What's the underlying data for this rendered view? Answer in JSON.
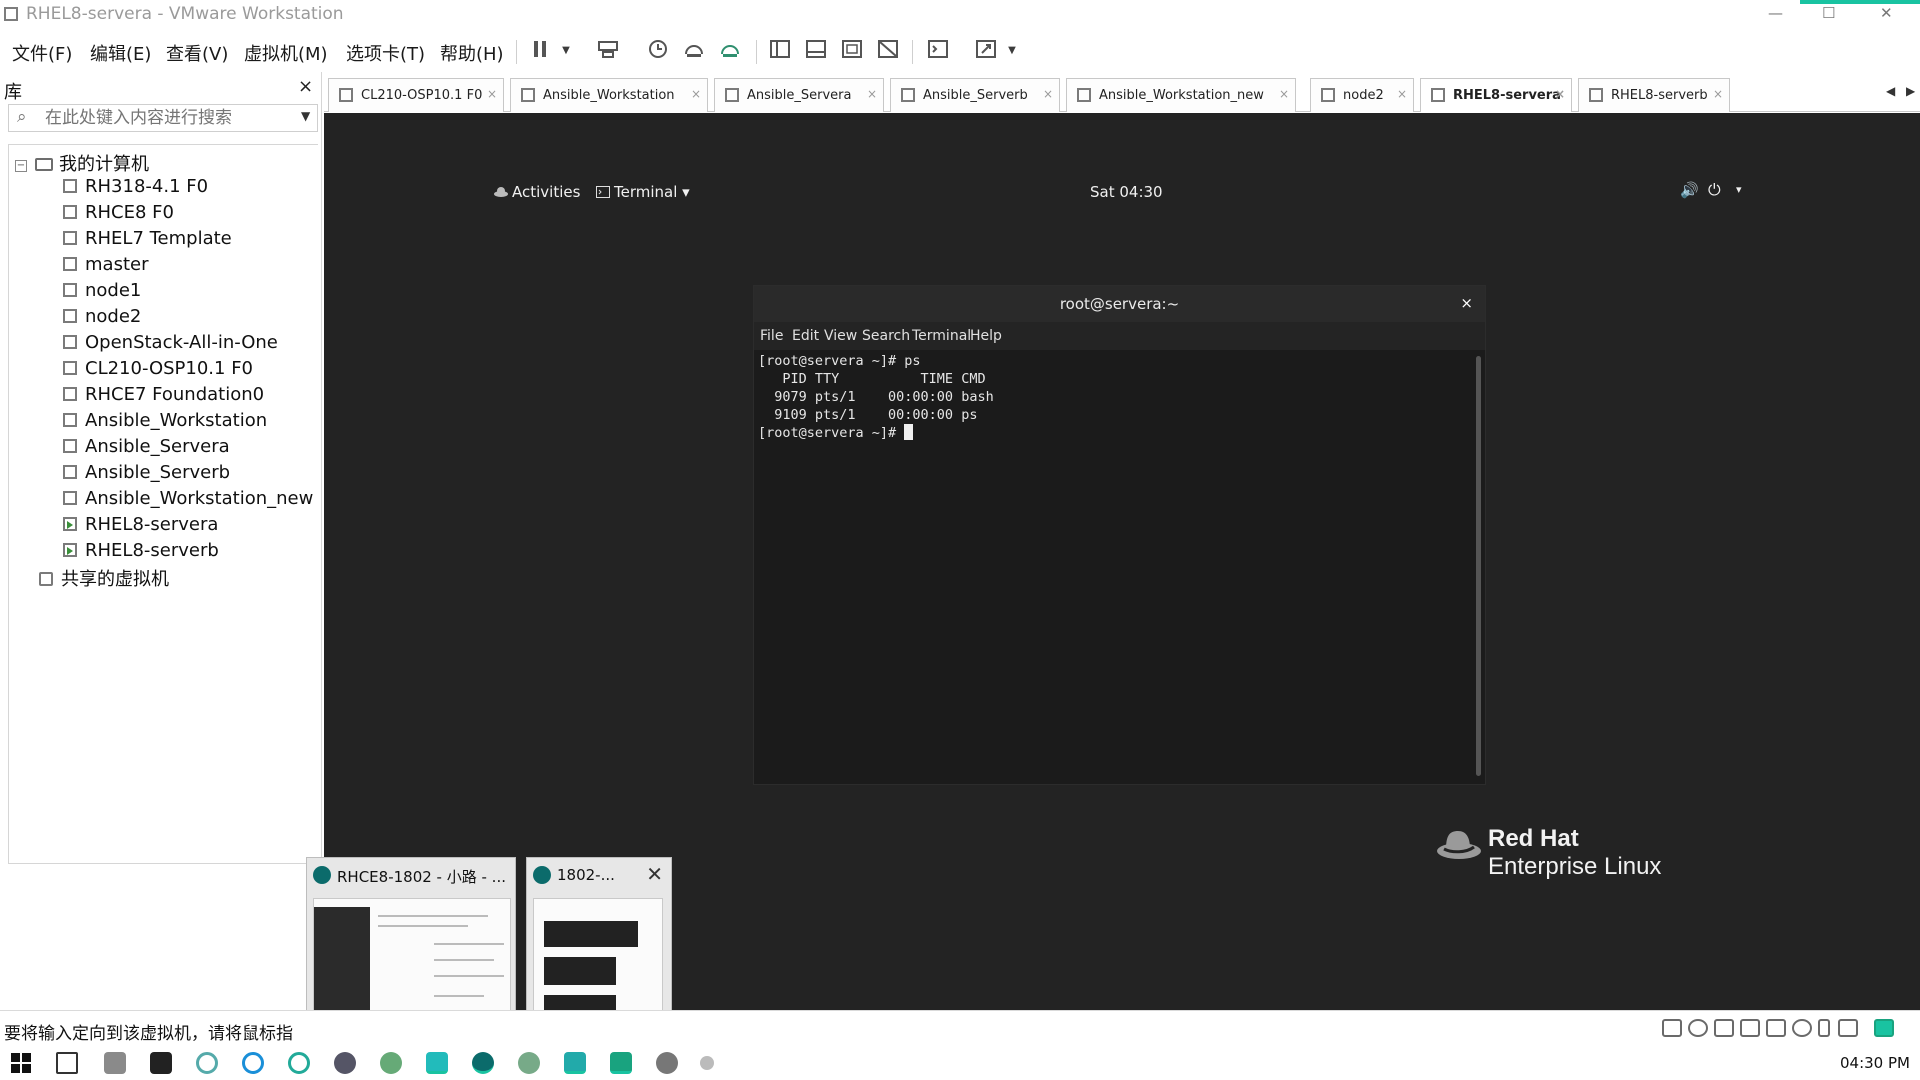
{
  "window": {
    "title": "RHEL8-servera - VMware Workstation",
    "min": "—",
    "max": "☐",
    "close": "✕"
  },
  "menu": [
    "文件(F)",
    "编辑(E)",
    "查看(V)",
    "虚拟机(M)",
    "选项卡(T)",
    "帮助(H)"
  ],
  "library": {
    "title": "库",
    "close": "×",
    "search_placeholder": "在此处键入内容进行搜索",
    "root": "我的计算机",
    "vms": [
      {
        "name": "RH318-4.1 F0",
        "running": false
      },
      {
        "name": "RHCE8 F0",
        "running": false
      },
      {
        "name": "RHEL7 Template",
        "running": false
      },
      {
        "name": "master",
        "running": false
      },
      {
        "name": "node1",
        "running": false
      },
      {
        "name": "node2",
        "running": false
      },
      {
        "name": "OpenStack-All-in-One",
        "running": false
      },
      {
        "name": "CL210-OSP10.1 F0",
        "running": false
      },
      {
        "name": "RHCE7 Foundation0",
        "running": false
      },
      {
        "name": "Ansible_Workstation",
        "running": false
      },
      {
        "name": "Ansible_Servera",
        "running": false
      },
      {
        "name": "Ansible_Serverb",
        "running": false
      },
      {
        "name": "Ansible_Workstation_new",
        "running": false
      },
      {
        "name": "RHEL8-servera",
        "running": true
      },
      {
        "name": "RHEL8-serverb",
        "running": true
      }
    ],
    "shared": "共享的虚拟机"
  },
  "tabs": [
    {
      "label": "CL210-OSP10.1 F0",
      "active": false
    },
    {
      "label": "Ansible_Workstation",
      "active": false
    },
    {
      "label": "Ansible_Servera",
      "active": false
    },
    {
      "label": "Ansible_Serverb",
      "active": false
    },
    {
      "label": "Ansible_Workstation_new",
      "active": false
    },
    {
      "label": "node2",
      "active": false
    },
    {
      "label": "RHEL8-servera",
      "active": true
    },
    {
      "label": "RHEL8-serverb",
      "active": false
    }
  ],
  "tab_close": "×",
  "gnome": {
    "activities": "Activities",
    "terminal_menu": "Terminal ▾",
    "clock": "Sat 04:30",
    "volume": "🔊",
    "power": "⏻",
    "arrow": "▾"
  },
  "terminal": {
    "title": "root@servera:~",
    "close": "×",
    "menus": [
      "File",
      "Edit",
      "View",
      "Search",
      "Terminal",
      "Help"
    ],
    "lines": [
      "[root@servera ~]# ps",
      "   PID TTY          TIME CMD",
      "  9079 pts/1    00:00:00 bash",
      "  9109 pts/1    00:00:00 ps"
    ],
    "prompt": "[root@servera ~]# "
  },
  "redhat": {
    "line1": "Red Hat",
    "line2": "Enterprise Linux"
  },
  "previews": [
    {
      "title": "RHCE8-1802 - 小路 - ..."
    },
    {
      "title": "1802-..."
    }
  ],
  "preview_close": "✕",
  "status": {
    "text": "要将输入定向到该虚拟机，请将鼠标指"
  },
  "taskbar": {
    "clock": "04:30 PM"
  }
}
